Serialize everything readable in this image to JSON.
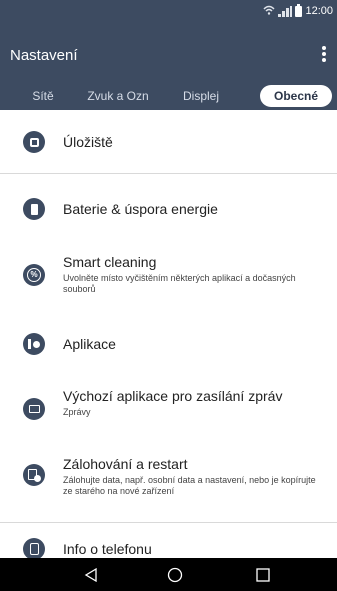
{
  "status_bar": {
    "time": "12:00",
    "wifi_icon": "wifi-icon",
    "signal_icon": "signal-icon",
    "battery_icon": "battery-icon"
  },
  "app_bar": {
    "title": "Nastavení",
    "menu_icon": "more-vert-icon"
  },
  "tabs": [
    {
      "label": "Sítě",
      "active": false
    },
    {
      "label": "Zvuk a Ozn",
      "active": false
    },
    {
      "label": "Displej",
      "active": false
    },
    {
      "label": "Obecné",
      "active": true
    }
  ],
  "settings": [
    {
      "title": "Úložiště",
      "subtitle": "",
      "icon": "storage-icon"
    },
    {
      "title": "Baterie & úspora energie",
      "subtitle": "",
      "icon": "battery-icon"
    },
    {
      "title": "Smart cleaning",
      "subtitle": "Uvolněte místo vyčištěním některých aplikací a dočasných souborů",
      "icon": "smart-cleaning-icon"
    },
    {
      "title": "Aplikace",
      "subtitle": "",
      "icon": "apps-icon"
    },
    {
      "title": "Výchozí aplikace pro zasílání zpráv",
      "subtitle": "Zprávy",
      "icon": "message-icon"
    },
    {
      "title": "Zálohování a restart",
      "subtitle": "Zálohujte data, např. osobní data a nastavení, nebo je kopírujte ze starého na nové zařízení",
      "icon": "backup-icon"
    },
    {
      "title": "Info o telefonu",
      "subtitle": "",
      "icon": "phone-info-icon"
    }
  ],
  "nav_bar": {
    "back": "back-icon",
    "home": "home-icon",
    "recents": "recents-icon"
  },
  "colors": {
    "header_bg": "#3d4b61",
    "icon_bg": "#3d4b61",
    "active_tab_text": "#2c3649",
    "nav_bg": "#000000"
  }
}
